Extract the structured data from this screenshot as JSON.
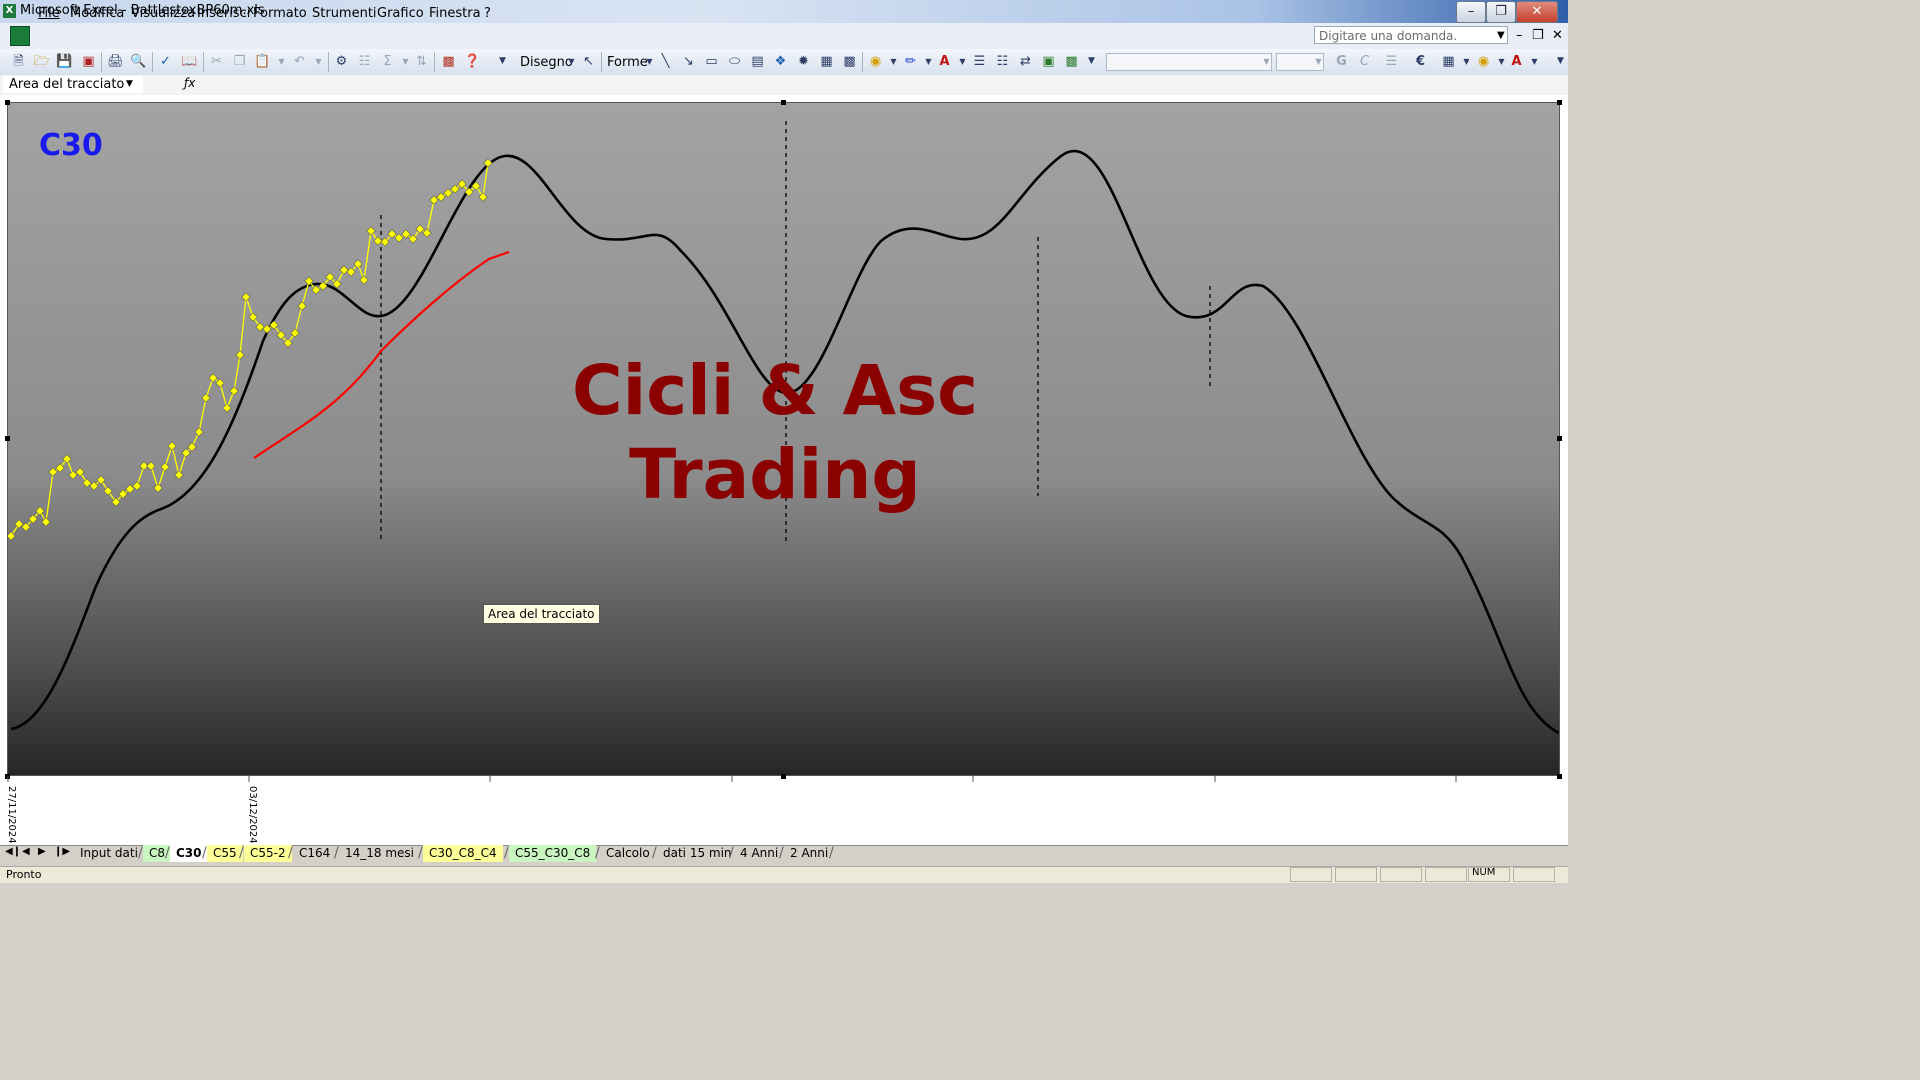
{
  "window": {
    "title": "Microsoft Excel - BattlestoxBP60m.xls"
  },
  "menu": [
    "File",
    "Modifica",
    "Visualizza",
    "Inserisci",
    "Formato",
    "Strumenti",
    "Grafico",
    "Finestra",
    "?"
  ],
  "help_box": {
    "placeholder": "Digitare una domanda."
  },
  "toolbar": {
    "drawing_label": "Disegno",
    "shapes_label": "Forme"
  },
  "name_box": {
    "value": "Area del tracciato"
  },
  "chart": {
    "corner_label": "C30",
    "watermark_line1": "Cicli & Asc",
    "watermark_line2": "Trading",
    "tooltip": "Area del tracciato",
    "date_labels": [
      "27/11/2024",
      "03/12/2024"
    ],
    "colors": {
      "price": "#ffff00",
      "cycle": "#000000",
      "trend": "#ff0000",
      "label": "#1a1aee",
      "watermark": "#8b0000"
    }
  },
  "sheet_tabs": [
    "Input dati",
    "C8",
    "C30",
    "C55",
    "C55-2",
    "C164",
    "14_18 mesi",
    "C30_C8_C4",
    "C55_C30_C8",
    "Calcolo",
    "dati 15 min",
    "4 Anni",
    "2 Anni"
  ],
  "active_tab": "C30",
  "status": {
    "left": "Pronto",
    "num": "NUM"
  }
}
